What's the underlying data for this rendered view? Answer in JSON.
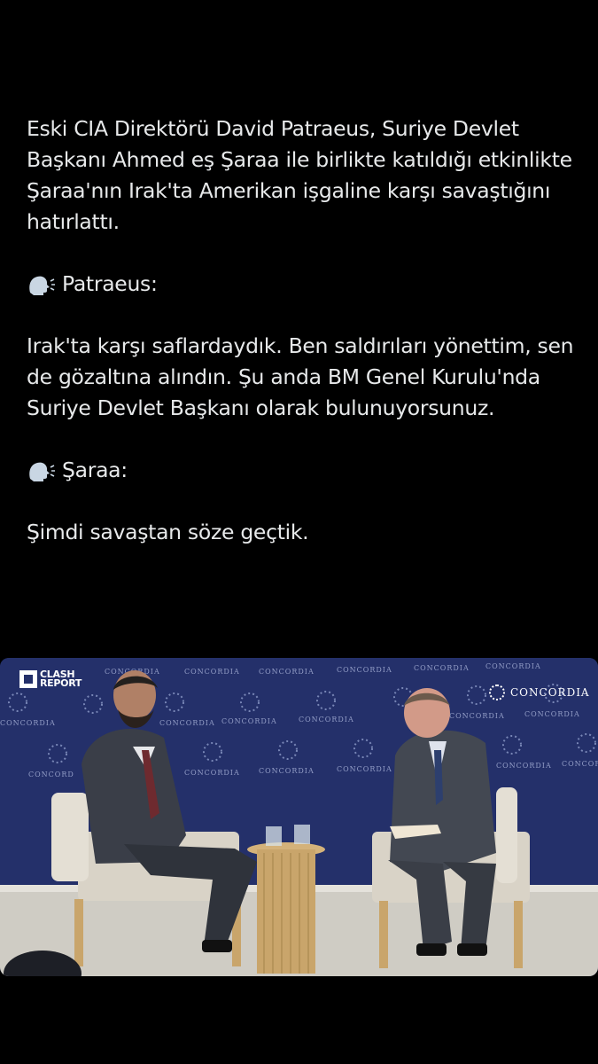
{
  "post": {
    "paragraph_1": "Eski CIA Direktörü David Patraeus, Suriye Devlet Başkanı Ahmed eş Şaraa ile birlikte katıldığı etkinlikte Şaraa'nın Irak'ta Amerikan işgaline karşı savaştığını hatırlattı.",
    "speaker_1_name": "Patraeus:",
    "speaker_1_quote": "Irak'ta karşı saflardaydık. Ben saldırıları yönettim, sen de gözaltına alındın. Şu anda BM Genel Kurulu'nda Suriye Devlet Başkanı olarak bulunuyorsunuz.",
    "speaker_2_name": "Şaraa:",
    "speaker_2_quote": "Şimdi savaştan söze geçtik.",
    "speaker_icon": "speaking-head-icon"
  },
  "media": {
    "watermark_line_1": "CLASH",
    "watermark_line_2": "REPORT",
    "backdrop_brand": "CONCORDIA",
    "colors": {
      "backdrop": "#24306a",
      "floor": "#cfccc4",
      "chair": "#d9d3c7",
      "table": "#c9a56b"
    }
  },
  "colors": {
    "background": "#000000",
    "text": "#e7e9ea"
  }
}
